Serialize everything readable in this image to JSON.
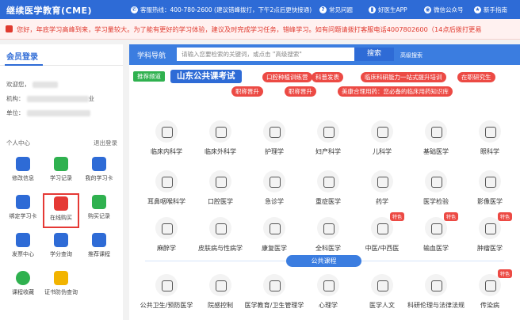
{
  "topbar": {
    "brand": "继续医学教育(CME)",
    "hotline": "客服热线：400-780-2600 (建议错峰拨打，下午2点后更快接通)",
    "faq": "常见问题",
    "app": "好医生APP",
    "wechat": "微信公众号",
    "guide": "新手指南"
  },
  "notice": {
    "text": "您好，年底学习高峰到来，学习量较大。为了能有更好的学习体验，建议及时完成学习任务，错峰学习。如有问题请拨打客服电话4007802600（14点后拨打更易"
  },
  "left": {
    "title": "会员登录",
    "welcome_label": "欢迎您，",
    "org_label": "机构：",
    "org_tail": "业",
    "unit_label": "单位：",
    "personal_center": "个人中心",
    "logout": "退出登录",
    "items": [
      {
        "label": "修改信息",
        "icon": "edit-icon",
        "color": "#2e6bd6"
      },
      {
        "label": "学习记录",
        "icon": "record-icon",
        "color": "#2fb14f"
      },
      {
        "label": "我的学习卡",
        "icon": "card-icon",
        "color": "#2e6bd6"
      },
      {
        "label": "绑定学习卡",
        "icon": "bind-card-icon",
        "color": "#2e6bd6"
      },
      {
        "label": "在线购买",
        "icon": "online-buy-icon",
        "color": "#e53935"
      },
      {
        "label": "购买记录",
        "icon": "purchase-record-icon",
        "color": "#2fb14f"
      },
      {
        "label": "发票中心",
        "icon": "invoice-icon",
        "color": "#2e6bd6"
      },
      {
        "label": "学分查询",
        "icon": "credit-query-icon",
        "color": "#2e6bd6"
      },
      {
        "label": "推荐课程",
        "icon": "recommend-icon",
        "color": "#2e6bd6"
      },
      {
        "label": "课程收藏",
        "icon": "favorite-icon",
        "color": "#2fb14f"
      },
      {
        "label": "证书防伪查询",
        "icon": "certificate-icon",
        "color": "#f2b400"
      }
    ]
  },
  "search": {
    "nav_label": "学科导航",
    "placeholder": "请输入您要检索的关键词，或点击 \"高级搜索\"",
    "button": "搜索",
    "advanced": "高级搜索"
  },
  "recommend": {
    "tag": "推荐频道",
    "main": "山东公共课考试",
    "pills": [
      "口腔种植训练营",
      "科普发表",
      "临床科研能力一站式提升培训",
      "在职研究生",
      "职称晋升",
      "职称晋升",
      "美康合理用药：您必备的临床用药知识库"
    ]
  },
  "categories": [
    {
      "label": "临床内科学",
      "icon": "stethoscope-icon"
    },
    {
      "label": "临床外科学",
      "icon": "scalpel-icon"
    },
    {
      "label": "护理学",
      "icon": "nurse-icon"
    },
    {
      "label": "妇产科学",
      "icon": "pregnancy-icon"
    },
    {
      "label": "儿科学",
      "icon": "baby-icon"
    },
    {
      "label": "基础医学",
      "icon": "stethoscope-icon"
    },
    {
      "label": "眼科学",
      "icon": "eye-icon"
    },
    {
      "label": "耳鼻咽喉科学",
      "icon": "ear-icon"
    },
    {
      "label": "口腔医学",
      "icon": "tooth-icon"
    },
    {
      "label": "急诊学",
      "icon": "emergency-icon"
    },
    {
      "label": "重症医学",
      "icon": "icu-icon"
    },
    {
      "label": "药学",
      "icon": "pill-icon"
    },
    {
      "label": "医学检验",
      "icon": "microscope-icon"
    },
    {
      "label": "影像医学",
      "icon": "imaging-icon"
    },
    {
      "label": "麻醉学",
      "icon": "syringe-icon"
    },
    {
      "label": "皮肤病与性病学",
      "icon": "skin-icon"
    },
    {
      "label": "康复医学",
      "icon": "rehab-icon"
    },
    {
      "label": "全科医学",
      "icon": "general-icon"
    },
    {
      "label": "中医/中西医",
      "icon": "tcm-icon",
      "badge": "特色"
    },
    {
      "label": "输血医学",
      "icon": "blood-icon",
      "badge": "特色"
    },
    {
      "label": "肿瘤医学",
      "icon": "tumor-icon",
      "badge": "特色"
    }
  ],
  "public_courses": {
    "title": "公共课程",
    "items": [
      {
        "label": "公共卫生/预防医学",
        "icon": "public-health-icon"
      },
      {
        "label": "院感控制",
        "icon": "mask-icon"
      },
      {
        "label": "医学教育/卫生管理学",
        "icon": "education-icon"
      },
      {
        "label": "心理学",
        "icon": "heart-icon"
      },
      {
        "label": "医学人文",
        "icon": "humanities-icon"
      },
      {
        "label": "科研伦理与法律法规",
        "icon": "law-icon"
      },
      {
        "label": "传染病",
        "icon": "virus-icon",
        "badge": "特色"
      }
    ]
  }
}
